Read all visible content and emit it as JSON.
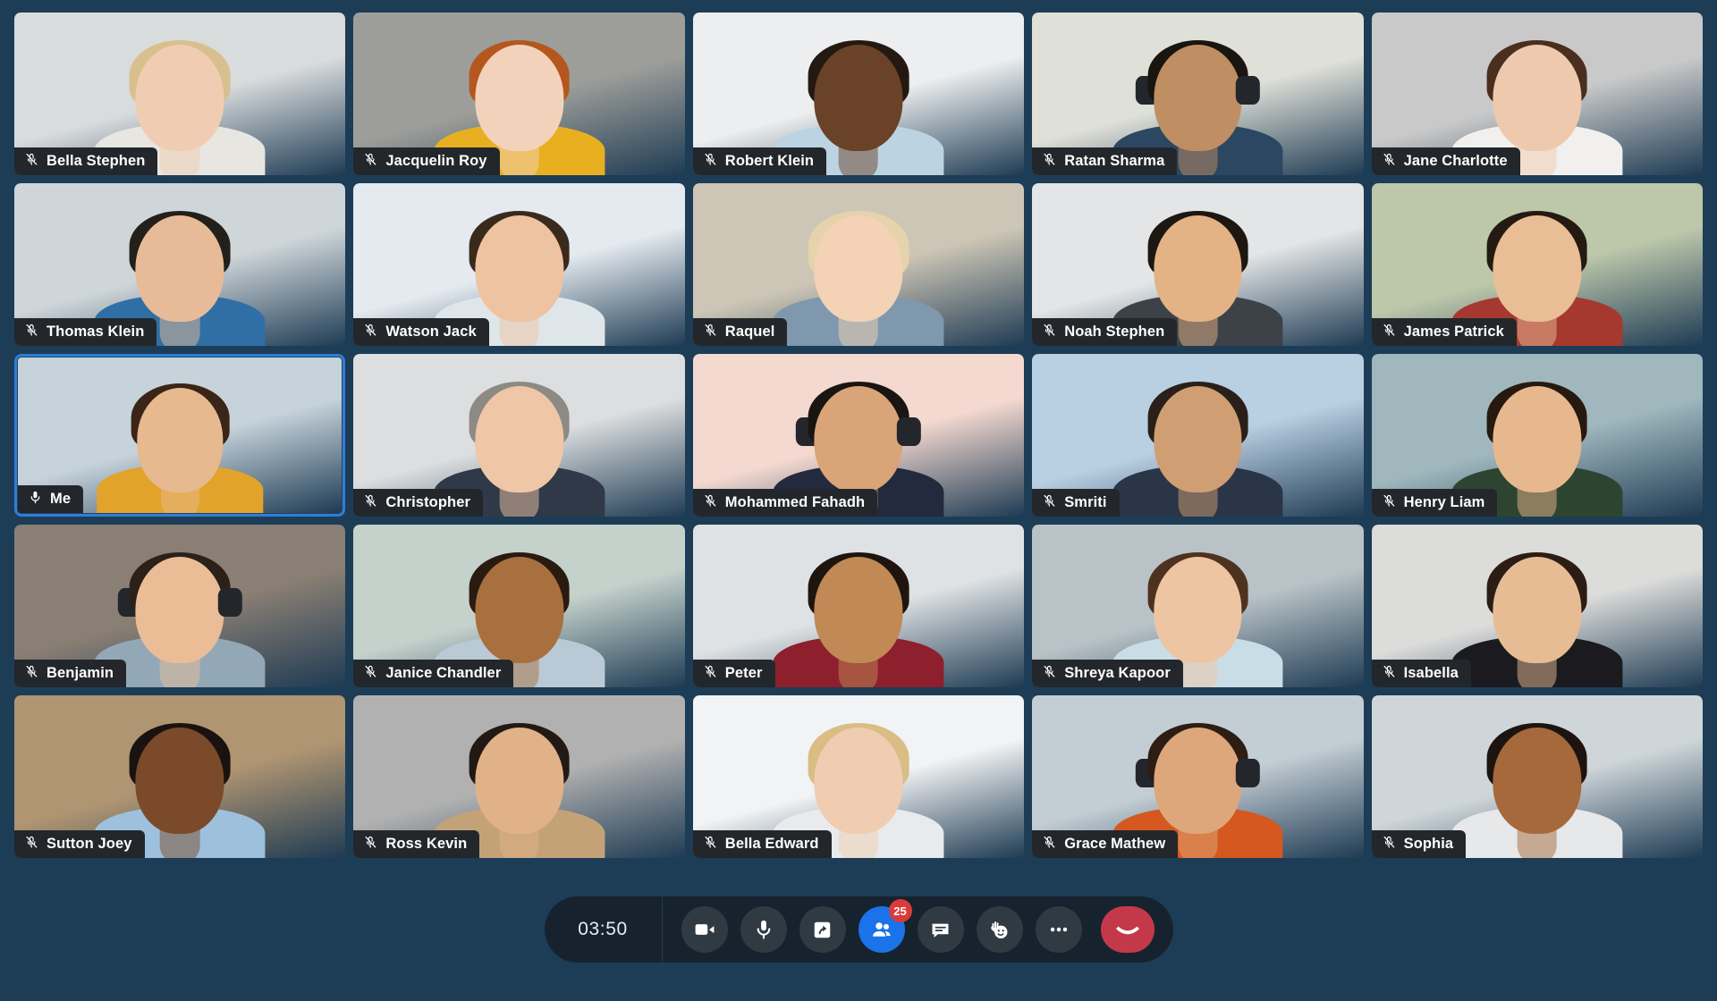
{
  "meeting": {
    "background_color": "#1d3c56",
    "self_highlight_color": "#2f7ddb"
  },
  "grid": {
    "columns": 5,
    "rows": 5,
    "tiles": [
      {
        "name": "Bella Stephen",
        "muted": true,
        "is_self": false,
        "mic_icon": "mic-muted-icon",
        "bg": "#d9dcdd",
        "skin": "#f0cdb2",
        "hair": "#d8c08e",
        "shirt": "#e8e6e1",
        "headset": false
      },
      {
        "name": "Jacquelin Roy",
        "muted": true,
        "is_self": false,
        "mic_icon": "mic-muted-icon",
        "bg": "#9d9e9a",
        "skin": "#f3d2bb",
        "hair": "#b4571f",
        "shirt": "#e8b020",
        "headset": false
      },
      {
        "name": "Robert Klein",
        "muted": true,
        "is_self": false,
        "mic_icon": "mic-muted-icon",
        "bg": "#eceeef",
        "skin": "#6a4228",
        "hair": "#241912",
        "shirt": "#bcd3e2",
        "headset": false
      },
      {
        "name": "Ratan Sharma",
        "muted": true,
        "is_self": false,
        "mic_icon": "mic-muted-icon",
        "bg": "#dfe0d8",
        "skin": "#c08e63",
        "hair": "#19150f",
        "shirt": "#2c4761",
        "headset": true
      },
      {
        "name": "Jane Charlotte",
        "muted": true,
        "is_self": false,
        "mic_icon": "mic-muted-icon",
        "bg": "#c9c9c9",
        "skin": "#efc9ae",
        "hair": "#4a2e1e",
        "shirt": "#f2f0ee",
        "headset": false
      },
      {
        "name": "Thomas Klein",
        "muted": true,
        "is_self": false,
        "bg": "#cfd6da",
        "skin": "#e8bb98",
        "hair": "#23201c",
        "shirt": "#2f6fa5",
        "mic_icon": "mic-muted-icon",
        "headset": false
      },
      {
        "name": "Watson Jack",
        "muted": true,
        "is_self": false,
        "bg": "#e4eaef",
        "skin": "#eec3a1",
        "hair": "#3a2a1c",
        "shirt": "#dfe6ea",
        "mic_icon": "mic-muted-icon",
        "headset": false
      },
      {
        "name": "Raquel",
        "muted": true,
        "is_self": false,
        "bg": "#cdc6b6",
        "skin": "#f3d2b6",
        "hair": "#e4d3ab",
        "shirt": "#7f98ad",
        "mic_icon": "mic-muted-icon",
        "headset": false
      },
      {
        "name": "Noah Stephen",
        "muted": true,
        "is_self": false,
        "bg": "#e3e5e6",
        "skin": "#e3b285",
        "hair": "#1d1712",
        "shirt": "#3d4249",
        "mic_icon": "mic-muted-icon",
        "headset": false
      },
      {
        "name": "James Patrick",
        "muted": true,
        "is_self": false,
        "bg": "#bdc8ab",
        "skin": "#e9bd95",
        "hair": "#241a12",
        "shirt": "#a6392f",
        "mic_icon": "mic-muted-icon",
        "headset": false
      },
      {
        "name": "Me",
        "muted": false,
        "is_self": true,
        "bg": "#c6d3db",
        "skin": "#e6b98f",
        "hair": "#3b2418",
        "shirt": "#e2a32a",
        "mic_icon": "mic-on-icon",
        "headset": false
      },
      {
        "name": "Christopher",
        "muted": true,
        "is_self": false,
        "bg": "#dcdedf",
        "skin": "#efc6a6",
        "hair": "#8d8a84",
        "shirt": "#2f3947",
        "mic_icon": "mic-muted-icon",
        "headset": false
      },
      {
        "name": "Mohammed Fahadh",
        "muted": true,
        "is_self": false,
        "bg": "#f4d9d0",
        "skin": "#d9a578",
        "hair": "#1b1511",
        "shirt": "#242a3d",
        "mic_icon": "mic-muted-icon",
        "headset": true
      },
      {
        "name": "Smriti",
        "muted": true,
        "is_self": false,
        "bg": "#b9cfe2",
        "skin": "#cf9f73",
        "hair": "#2a2019",
        "shirt": "#2a3547",
        "mic_icon": "mic-muted-icon",
        "headset": false
      },
      {
        "name": "Henry Liam",
        "muted": true,
        "is_self": false,
        "bg": "#9fb7bd",
        "skin": "#e7b88e",
        "hair": "#26190f",
        "shirt": "#2d4530",
        "mic_icon": "mic-muted-icon",
        "headset": false
      },
      {
        "name": "Benjamin",
        "muted": true,
        "is_self": false,
        "bg": "#8a7f74",
        "skin": "#eabd97",
        "hair": "#2b2119",
        "shirt": "#93a8b6",
        "mic_icon": "mic-muted-icon",
        "headset": true
      },
      {
        "name": "Janice Chandler",
        "muted": true,
        "is_self": false,
        "bg": "#c5d2cc",
        "skin": "#a9703f",
        "hair": "#2a1b11",
        "shirt": "#b9cad6",
        "mic_icon": "mic-muted-icon",
        "headset": false
      },
      {
        "name": "Peter",
        "muted": true,
        "is_self": false,
        "bg": "#dfe2e4",
        "skin": "#c08955",
        "hair": "#1e150f",
        "shirt": "#8e1f2c",
        "mic_icon": "mic-muted-icon",
        "headset": false
      },
      {
        "name": "Shreya Kapoor",
        "muted": true,
        "is_self": false,
        "bg": "#b9c3c7",
        "skin": "#eec5a2",
        "hair": "#4e3220",
        "shirt": "#c9dde6",
        "mic_icon": "mic-muted-icon",
        "headset": false
      },
      {
        "name": "Isabella",
        "muted": true,
        "is_self": false,
        "bg": "#dcdcda",
        "skin": "#e7bc95",
        "hair": "#2b1d13",
        "shirt": "#1b1b1f",
        "mic_icon": "mic-muted-icon",
        "headset": false
      },
      {
        "name": "Sutton Joey",
        "muted": true,
        "is_self": false,
        "bg": "#b09572",
        "skin": "#7a4a2a",
        "hair": "#1a1210",
        "shirt": "#9dc0dd",
        "mic_icon": "mic-muted-icon",
        "headset": false
      },
      {
        "name": "Ross Kevin",
        "muted": true,
        "is_self": false,
        "bg": "#b1b1b1",
        "skin": "#e1b188",
        "hair": "#221913",
        "shirt": "#c3a278",
        "mic_icon": "mic-muted-icon",
        "headset": false
      },
      {
        "name": "Bella Edward",
        "muted": true,
        "is_self": false,
        "bg": "#f2f3f4",
        "skin": "#f0cdb0",
        "hair": "#d9bd84",
        "shirt": "#e9eaec",
        "mic_icon": "mic-muted-icon",
        "headset": false
      },
      {
        "name": "Grace Mathew",
        "muted": true,
        "is_self": false,
        "bg": "#c3cdd4",
        "skin": "#dda77b",
        "hair": "#2e1d13",
        "shirt": "#d4581f",
        "mic_icon": "mic-muted-icon",
        "headset": true
      },
      {
        "name": "Sophia",
        "muted": true,
        "is_self": false,
        "bg": "#cfd6d9",
        "skin": "#a5693b",
        "hair": "#1d1410",
        "shirt": "#e6e8ea",
        "mic_icon": "mic-muted-icon",
        "headset": false
      }
    ]
  },
  "controls": {
    "timer": "03:50",
    "buttons": [
      {
        "key": "camera",
        "label": "Camera",
        "icon": "video-camera-icon",
        "style": "neutral"
      },
      {
        "key": "microphone",
        "label": "Microphone",
        "icon": "microphone-icon",
        "style": "neutral"
      },
      {
        "key": "share_screen",
        "label": "Share screen",
        "icon": "share-screen-icon",
        "style": "neutral"
      },
      {
        "key": "participants",
        "label": "Participants",
        "icon": "participants-icon",
        "style": "accent",
        "badge": "25"
      },
      {
        "key": "chat",
        "label": "Chat",
        "icon": "chat-bubble-icon",
        "style": "neutral"
      },
      {
        "key": "reactions",
        "label": "Reactions",
        "icon": "raise-hand-emoji-icon",
        "style": "neutral"
      },
      {
        "key": "more",
        "label": "More options",
        "icon": "more-options-icon",
        "style": "neutral"
      },
      {
        "key": "end_call",
        "label": "End call",
        "icon": "end-call-icon",
        "style": "danger"
      }
    ],
    "accent_color": "#1a73e8",
    "danger_color": "#c4394a",
    "badge_color": "#d93a3a"
  }
}
